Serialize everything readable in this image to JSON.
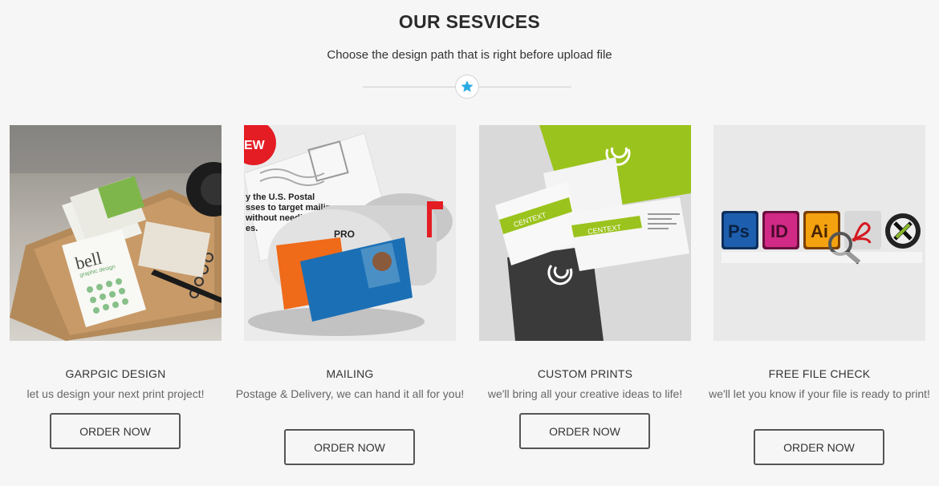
{
  "header": {
    "title": "OUR SESVICES",
    "subtitle": "Choose the design path that is right before upload file"
  },
  "colors": {
    "accent": "#29abe2",
    "lime": "#9bc31d",
    "button_border": "#555555"
  },
  "services": [
    {
      "name": "GARPGIC DESIGN",
      "description": "let us design your next print project!",
      "button": "ORDER NOW",
      "image_card_text": "bell",
      "image_card_subtext": "graphic design"
    },
    {
      "name": "MAILING",
      "description": "Postage & Delivery, we can hand it all for you!",
      "button": "ORDER NOW",
      "image_letter_text": "y the U.S. Postal sses to target mailings without needing to have es.",
      "image_badge": "EW",
      "image_mailbox_text": "PRO"
    },
    {
      "name": "CUSTOM PRINTS",
      "description": "we'll bring all your creative ideas to life!",
      "button": "ORDER NOW",
      "image_brand": "CENTEXT"
    },
    {
      "name": "FREE FILE CHECK",
      "description": "we'll let you know if your file is ready to print!",
      "button": "ORDER NOW",
      "image_icons": [
        "Ps",
        "ID",
        "Ai"
      ]
    }
  ]
}
